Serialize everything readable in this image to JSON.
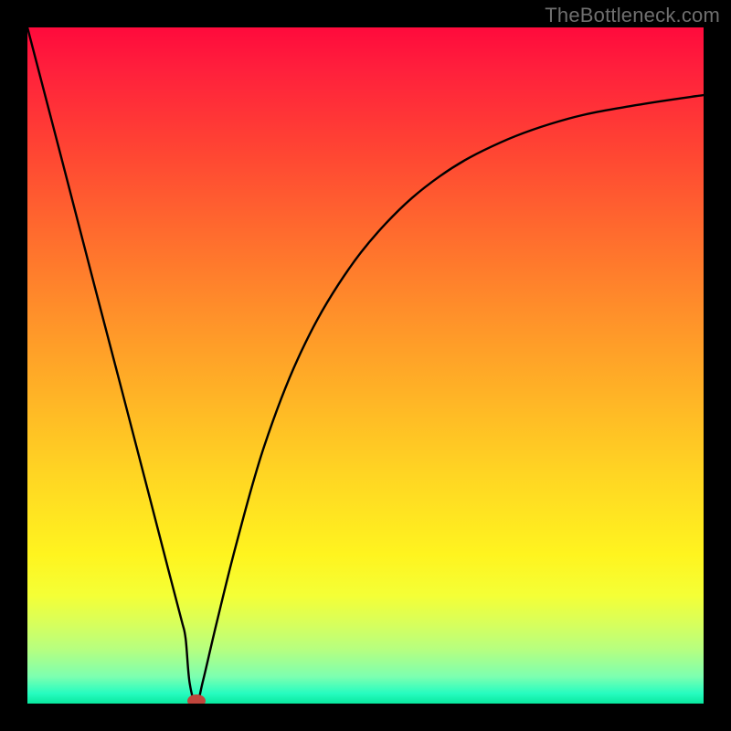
{
  "watermark": "TheBottleneck.com",
  "chart_data": {
    "type": "line",
    "title": "",
    "xlabel": "",
    "ylabel": "",
    "xlim": [
      0,
      100
    ],
    "ylim": [
      0,
      100
    ],
    "series": [
      {
        "name": "curve",
        "x": [
          0,
          5,
          10,
          14,
          18,
          21,
          22.8,
          23.4,
          24,
          25,
          26,
          28,
          31,
          35,
          40,
          46,
          53,
          61,
          70,
          80,
          90,
          100
        ],
        "y": [
          100,
          80.8,
          61.5,
          46.2,
          30.8,
          19.2,
          12.3,
          9.6,
          3.0,
          0.0,
          3.5,
          12.0,
          24.0,
          38.0,
          51.0,
          62.0,
          71.0,
          78.0,
          83.0,
          86.5,
          88.5,
          90.0
        ]
      }
    ],
    "marker": {
      "x": 25,
      "y": 0,
      "color": "#c0453c"
    },
    "gradient_stops": [
      {
        "pos": 0,
        "color": "#ff0a3c"
      },
      {
        "pos": 0.5,
        "color": "#ffb226"
      },
      {
        "pos": 0.85,
        "color": "#f4ff36"
      },
      {
        "pos": 1.0,
        "color": "#09e89e"
      }
    ]
  }
}
